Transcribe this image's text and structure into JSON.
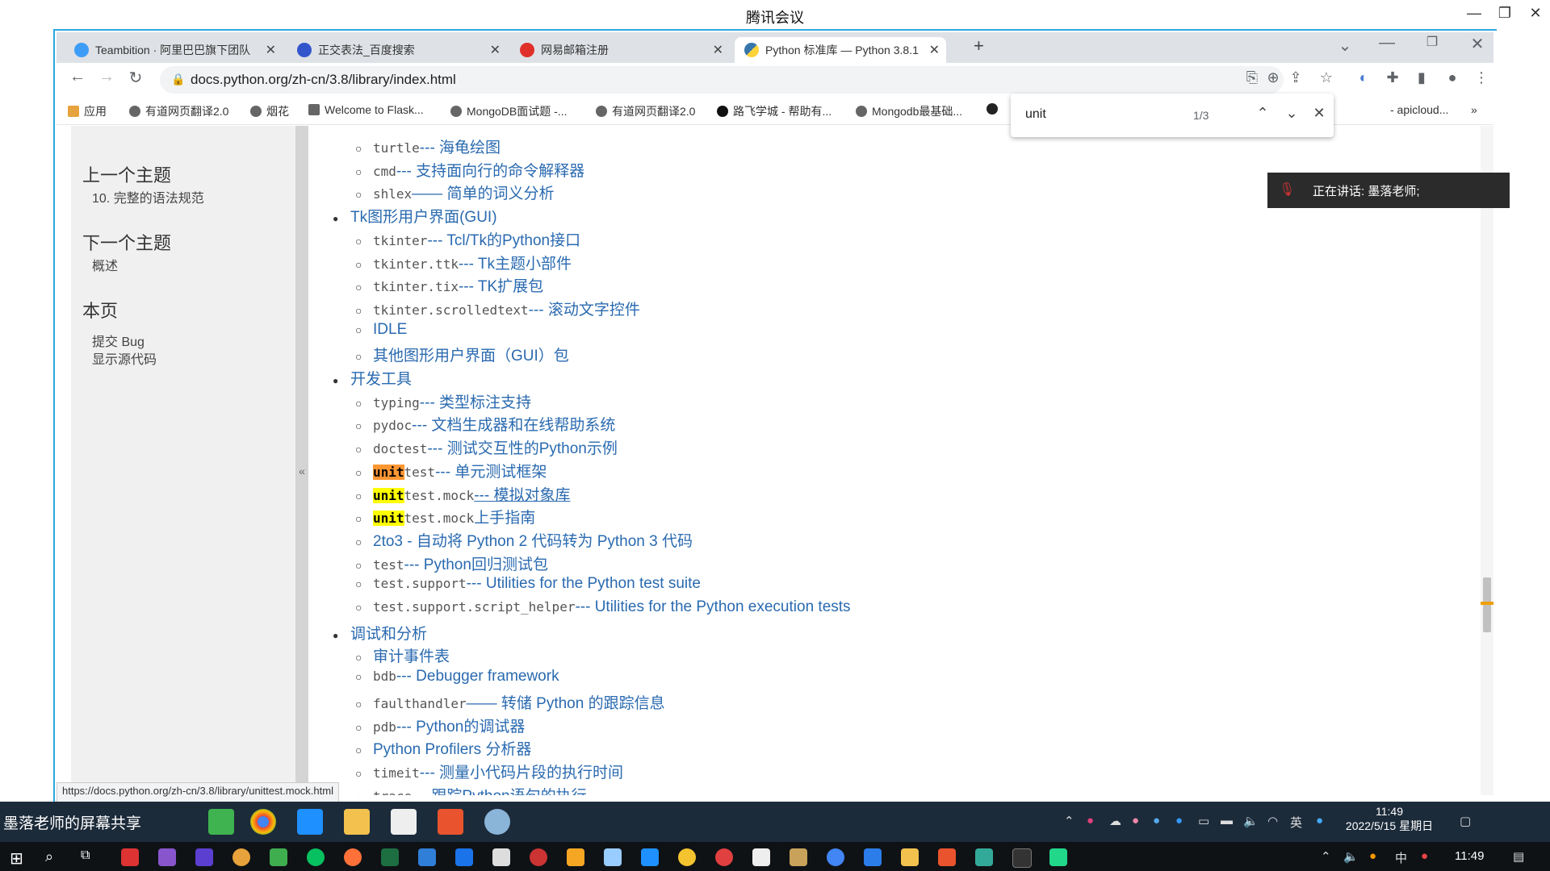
{
  "meeting": {
    "title": "腾讯会议",
    "speaking_label": "正在讲话: 墨落老师;",
    "share_label": "墨落老师的屏幕共享"
  },
  "browser": {
    "tabs": [
      {
        "label": "Teambition · 阿里巴巴旗下团队",
        "icon": "teambition-icon",
        "color": "#3d9df6",
        "active": false
      },
      {
        "label": "正交表法_百度搜索",
        "icon": "baidu-icon",
        "color": "#3355cc",
        "active": false
      },
      {
        "label": "网易邮箱注册",
        "icon": "netease-mail-icon",
        "color": "#e0302a",
        "active": false
      },
      {
        "label": "Python 标准库 — Python 3.8.1",
        "icon": "python-icon",
        "color": "#3776ab",
        "active": true
      }
    ],
    "url": "docs.python.org/zh-cn/3.8/library/index.html",
    "bookmarks": [
      "应用",
      "有道网页翻译2.0",
      "烟花",
      "Welcome to Flask...",
      "MongoDB面试题 -...",
      "有道网页翻译2.0",
      "路飞学城 - 帮助有...",
      "Mongodb最基础...",
      "- apicloud..."
    ],
    "find": {
      "query": "unit",
      "count": "1/3"
    },
    "status_url": "https://docs.python.org/zh-cn/3.8/library/unittest.mock.html"
  },
  "sidebar": {
    "prev_heading": "上一个主题",
    "prev_link": "10. 完整的语法规范",
    "next_heading": "下一个主题",
    "next_link": "概述",
    "this_page_heading": "本页",
    "report_bug": "提交 Bug",
    "show_source": "显示源代码",
    "collapse": "«"
  },
  "content": {
    "rows": [
      {
        "level": 2,
        "code": "turtle",
        "text": " --- 海龟绘图"
      },
      {
        "level": 2,
        "code": "cmd",
        "text": " --- 支持面向行的命令解释器"
      },
      {
        "level": 2,
        "code": "shlex",
        "text": " —— 简单的词义分析"
      },
      {
        "level": 1,
        "code": "",
        "text": "Tk图形用户界面(GUI)"
      },
      {
        "level": 2,
        "code": "tkinter",
        "text": " --- Tcl/Tk的Python接口"
      },
      {
        "level": 2,
        "code": "tkinter.ttk",
        "text": " --- Tk主题小部件"
      },
      {
        "level": 2,
        "code": "tkinter.tix",
        "text": " --- TK扩展包"
      },
      {
        "level": 2,
        "code": "tkinter.scrolledtext",
        "text": " --- 滚动文字控件"
      },
      {
        "level": 2,
        "code": "",
        "text": "IDLE"
      },
      {
        "level": 2,
        "code": "",
        "text": "其他图形用户界面（GUI）包"
      },
      {
        "level": 1,
        "code": "",
        "text": "开发工具"
      },
      {
        "level": 2,
        "code": "typing",
        "text": " --- 类型标注支持"
      },
      {
        "level": 2,
        "code": "pydoc",
        "text": " --- 文档生成器和在线帮助系统"
      },
      {
        "level": 2,
        "code": "doctest",
        "text": " --- 测试交互性的Python示例"
      },
      {
        "level": 2,
        "hl": "unit",
        "hl_color": "orange",
        "code": "test",
        "text": " --- 单元测试框架"
      },
      {
        "level": 2,
        "hl": "unit",
        "hl_color": "yellow",
        "code": "test.mock",
        "text": " --- 模拟对象库",
        "hovered": true
      },
      {
        "level": 2,
        "hl": "unit",
        "hl_color": "yellow",
        "code": "test.mock",
        "text": " 上手指南"
      },
      {
        "level": 2,
        "code": "",
        "text": "2to3 - 自动将 Python 2 代码转为 Python 3 代码"
      },
      {
        "level": 2,
        "code": "test",
        "text": " --- Python回归测试包"
      },
      {
        "level": 2,
        "code": "test.support",
        "text": " --- Utilities for the Python test suite"
      },
      {
        "level": 2,
        "code": "test.support.script_helper",
        "text": " --- Utilities for the Python execution tests"
      },
      {
        "level": 1,
        "code": "",
        "text": "调试和分析"
      },
      {
        "level": 2,
        "code": "",
        "text": "审计事件表"
      },
      {
        "level": 2,
        "code": "bdb",
        "text": " --- Debugger framework"
      },
      {
        "level": 2,
        "code": "faulthandler",
        "text": " —— 转储 Python 的跟踪信息"
      },
      {
        "level": 2,
        "code": "pdb",
        "text": " --- Python的调试器"
      },
      {
        "level": 2,
        "code": "",
        "text": "Python Profilers 分析器"
      },
      {
        "level": 2,
        "code": "timeit",
        "text": " --- 测量小代码片段的执行时间"
      },
      {
        "level": 2,
        "code": "trace",
        "text": " --- 跟踪Python语句的执行"
      }
    ]
  },
  "inner_taskbar": {
    "clock_time": "11:49",
    "clock_date": "2022/5/15 星期日",
    "ime_lang": "英"
  },
  "outer_taskbar": {
    "clock_time": "11:49",
    "ime_lang": "中"
  }
}
